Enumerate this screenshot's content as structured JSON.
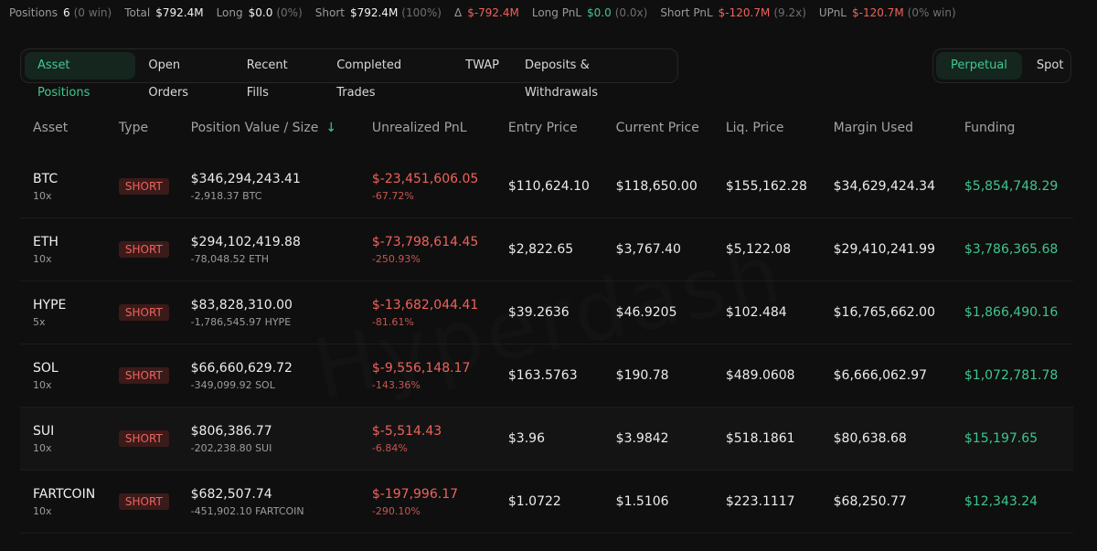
{
  "summary": {
    "positions_label": "Positions",
    "positions_value": "6",
    "positions_sub": "(0 win)",
    "total_label": "Total",
    "total_value": "$792.4M",
    "long_label": "Long",
    "long_value": "$0.0",
    "long_sub": "(0%)",
    "short_label": "Short",
    "short_value": "$792.4M",
    "short_sub": "(100%)",
    "delta_label": "Δ",
    "delta_value": "$-792.4M",
    "long_pnl_label": "Long PnL",
    "long_pnl_value": "$0.0",
    "long_pnl_sub": "(0.0x)",
    "short_pnl_label": "Short PnL",
    "short_pnl_value": "$-120.7M",
    "short_pnl_sub": "(9.2x)",
    "upnl_label": "UPnL",
    "upnl_value": "$-120.7M",
    "upnl_sub": "(0% win)"
  },
  "tabs": [
    "Asset Positions",
    "Open Orders",
    "Recent Fills",
    "Completed Trades",
    "TWAP",
    "Deposits & Withdrawals"
  ],
  "toggle": [
    "Perpetual",
    "Spot"
  ],
  "columns": [
    "Asset",
    "Type",
    "Position Value / Size",
    "Unrealized PnL",
    "Entry Price",
    "Current Price",
    "Liq. Price",
    "Margin Used",
    "Funding"
  ],
  "sort_arrow": "↓",
  "rows": [
    {
      "asset": "BTC",
      "leverage": "10x",
      "type": "SHORT",
      "value": "$346,294,243.41",
      "size": "-2,918.37 BTC",
      "pnl": "$-23,451,606.05",
      "pnl_pct": "-67.72%",
      "entry": "$110,624.10",
      "current": "$118,650.00",
      "liq": "$155,162.28",
      "margin": "$34,629,424.34",
      "funding": "$5,854,748.29"
    },
    {
      "asset": "ETH",
      "leverage": "10x",
      "type": "SHORT",
      "value": "$294,102,419.88",
      "size": "-78,048.52 ETH",
      "pnl": "$-73,798,614.45",
      "pnl_pct": "-250.93%",
      "entry": "$2,822.65",
      "current": "$3,767.40",
      "liq": "$5,122.08",
      "margin": "$29,410,241.99",
      "funding": "$3,786,365.68"
    },
    {
      "asset": "HYPE",
      "leverage": "5x",
      "type": "SHORT",
      "value": "$83,828,310.00",
      "size": "-1,786,545.97 HYPE",
      "pnl": "$-13,682,044.41",
      "pnl_pct": "-81.61%",
      "entry": "$39.2636",
      "current": "$46.9205",
      "liq": "$102.484",
      "margin": "$16,765,662.00",
      "funding": "$1,866,490.16"
    },
    {
      "asset": "SOL",
      "leverage": "10x",
      "type": "SHORT",
      "value": "$66,660,629.72",
      "size": "-349,099.92 SOL",
      "pnl": "$-9,556,148.17",
      "pnl_pct": "-143.36%",
      "entry": "$163.5763",
      "current": "$190.78",
      "liq": "$489.0608",
      "margin": "$6,666,062.97",
      "funding": "$1,072,781.78"
    },
    {
      "asset": "SUI",
      "leverage": "10x",
      "type": "SHORT",
      "value": "$806,386.77",
      "size": "-202,238.80 SUI",
      "pnl": "$-5,514.43",
      "pnl_pct": "-6.84%",
      "entry": "$3.96",
      "current": "$3.9842",
      "liq": "$518.1861",
      "margin": "$80,638.68",
      "funding": "$15,197.65"
    },
    {
      "asset": "FARTCOIN",
      "leverage": "10x",
      "type": "SHORT",
      "value": "$682,507.74",
      "size": "-451,902.10 FARTCOIN",
      "pnl": "$-197,996.17",
      "pnl_pct": "-290.10%",
      "entry": "$1.0722",
      "current": "$1.5106",
      "liq": "$223.1117",
      "margin": "$68,250.77",
      "funding": "$12,343.24"
    }
  ],
  "watermark": "Hyperdash",
  "colors": {
    "accent": "#40c890",
    "negative": "#f0625b",
    "positive": "#3fc58d",
    "background": "#0f0f0f"
  }
}
